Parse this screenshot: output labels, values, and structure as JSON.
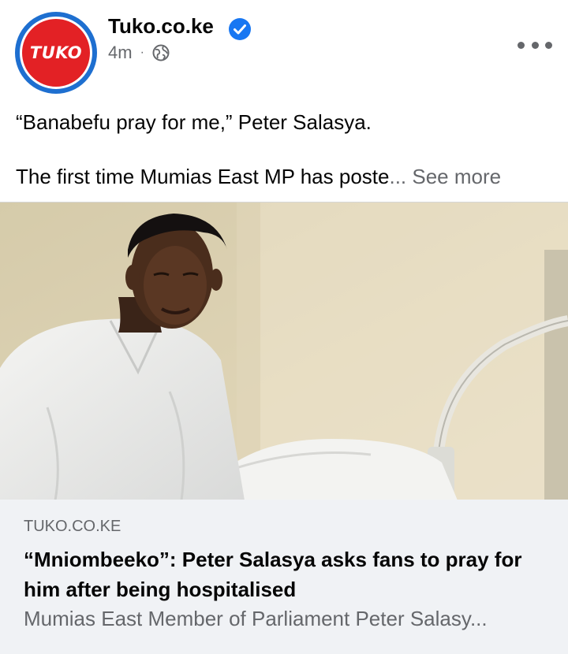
{
  "post": {
    "page_name": "Tuko.co.ke",
    "avatar_text": "TUKO",
    "time": "4m",
    "separator": "·",
    "audience_icon": "globe-icon",
    "verified_icon": "verified-badge-icon",
    "more_icon": "more-options-icon",
    "caption_line1": "“Banabefu pray for me,” Peter Salasya.",
    "caption_line2": "The first time Mumias East MP has poste",
    "caption_ellipsis": "...",
    "see_more": " See more"
  },
  "link_preview": {
    "domain": "TUKO.CO.KE",
    "title": "“Mniombeeko”: Peter Salasya asks fans to pray for him after being hospitalised",
    "description": "Mumias East Member of Parliament Peter Salasy..."
  },
  "colors": {
    "brand_red": "#e32125",
    "ring_blue": "#1e6fd0",
    "verified_blue": "#1877f2",
    "secondary_text": "#65676b",
    "link_box_bg": "#f0f2f5"
  }
}
